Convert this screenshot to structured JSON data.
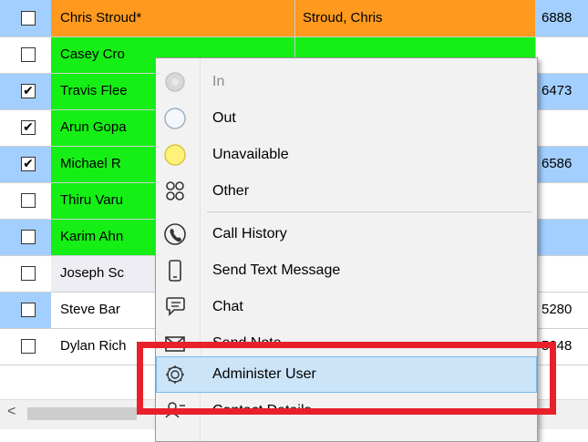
{
  "rows": [
    {
      "checked": false,
      "name": "Chris Stroud*",
      "last_first": "Stroud, Chris",
      "number": "6888",
      "chk_bg": "#a3cfff",
      "bg": "#ff9a1f",
      "num_bg": "#a3cfff"
    },
    {
      "checked": false,
      "name": "Casey Cro",
      "last_first": "",
      "number": "",
      "chk_bg": "#ffffff",
      "bg": "#15ef15",
      "num_bg": "#ffffff"
    },
    {
      "checked": true,
      "name": "Travis Flee",
      "last_first": "",
      "number": "6473",
      "chk_bg": "#a3cfff",
      "bg": "#15ef15",
      "num_bg": "#a3cfff"
    },
    {
      "checked": true,
      "name": "Arun Gopa",
      "last_first": "",
      "number": "",
      "chk_bg": "#ffffff",
      "bg": "#15ef15",
      "num_bg": "#ffffff"
    },
    {
      "checked": true,
      "name": "Michael R",
      "last_first": "",
      "number": "6586",
      "chk_bg": "#a3cfff",
      "bg": "#15ef15",
      "num_bg": "#a3cfff"
    },
    {
      "checked": false,
      "name": "Thiru Varu",
      "last_first": "",
      "number": "",
      "chk_bg": "#ffffff",
      "bg": "#15ef15",
      "num_bg": "#ffffff"
    },
    {
      "checked": false,
      "name": "Karim Ahn",
      "last_first": "",
      "number": "",
      "chk_bg": "#a3cfff",
      "bg": "#15ef15",
      "num_bg": "#a3cfff"
    },
    {
      "checked": false,
      "name": "Joseph Sc",
      "last_first": "",
      "number": "",
      "chk_bg": "#ffffff",
      "bg": "#ededf3",
      "num_bg": "#ffffff"
    },
    {
      "checked": false,
      "name": "Steve Bar",
      "last_first": "",
      "number": "5280",
      "chk_bg": "#a3cfff",
      "bg": "#ffffff",
      "num_bg": "#ffffff"
    },
    {
      "checked": false,
      "name": "Dylan Rich",
      "last_first": "",
      "number": "5248",
      "chk_bg": "#ffffff",
      "bg": "#ffffff",
      "num_bg": "#ffffff"
    }
  ],
  "scrollbar": {
    "left_arrow": "<"
  },
  "menu": {
    "items": [
      {
        "label": "In",
        "icon": "status-in-icon",
        "disabled": true
      },
      {
        "label": "Out",
        "icon": "status-out-icon",
        "disabled": false
      },
      {
        "label": "Unavailable",
        "icon": "status-unavailable-icon",
        "disabled": false
      },
      {
        "label": "Other",
        "icon": "status-other-icon",
        "disabled": false
      },
      {
        "label": "Call History",
        "icon": "call-history-icon",
        "disabled": false
      },
      {
        "label": "Send Text Message",
        "icon": "mobile-phone-icon",
        "disabled": false
      },
      {
        "label": "Chat",
        "icon": "chat-icon",
        "disabled": false
      },
      {
        "label": "Send Note",
        "icon": "envelope-icon",
        "disabled": false
      },
      {
        "label": "Administer User",
        "icon": "gear-icon",
        "disabled": false,
        "highlighted": true
      },
      {
        "label": "Contact Details",
        "icon": "contact-card-icon",
        "disabled": false
      }
    ]
  },
  "colors": {
    "highlight_box": "#e8202a",
    "menu_hover": "#cce4f7"
  }
}
